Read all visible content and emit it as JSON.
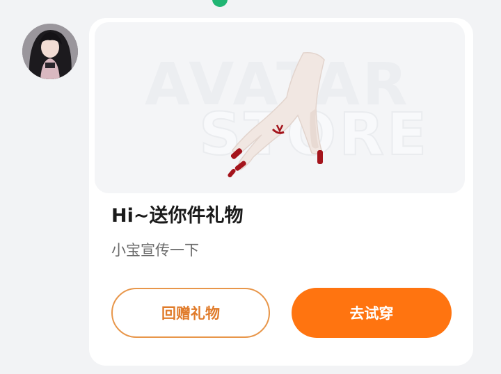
{
  "message": {
    "sender": {
      "avatar": "user-avatar"
    },
    "card": {
      "banner": {
        "watermark_line1": "AVATAR",
        "watermark_line2": "STORE",
        "item_icon": "hand-with-red-nails"
      },
      "title": "Hi~送你件礼物",
      "subtitle": "小宝宣传一下",
      "buttons": {
        "return_gift_label": "回赠礼物",
        "try_on_label": "去试穿"
      },
      "colors": {
        "primary": "#ff7410",
        "secondary_border": "#e8964a",
        "nail": "#a4141c"
      }
    }
  }
}
